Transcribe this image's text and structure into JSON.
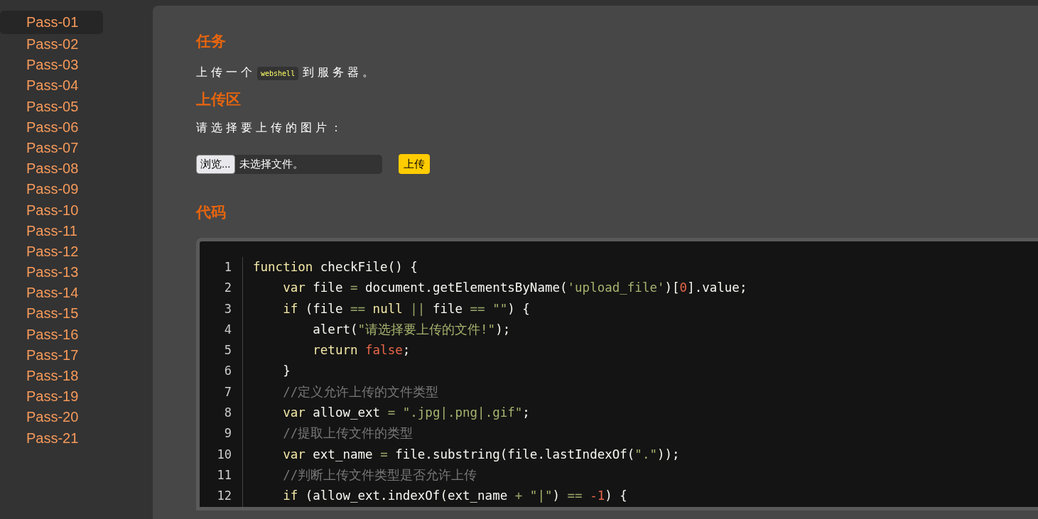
{
  "sidebar": {
    "items": [
      {
        "label": "Pass-01",
        "selected": true
      },
      {
        "label": "Pass-02",
        "selected": false
      },
      {
        "label": "Pass-03",
        "selected": false
      },
      {
        "label": "Pass-04",
        "selected": false
      },
      {
        "label": "Pass-05",
        "selected": false
      },
      {
        "label": "Pass-06",
        "selected": false
      },
      {
        "label": "Pass-07",
        "selected": false
      },
      {
        "label": "Pass-08",
        "selected": false
      },
      {
        "label": "Pass-09",
        "selected": false
      },
      {
        "label": "Pass-10",
        "selected": false
      },
      {
        "label": "Pass-11",
        "selected": false
      },
      {
        "label": "Pass-12",
        "selected": false
      },
      {
        "label": "Pass-13",
        "selected": false
      },
      {
        "label": "Pass-14",
        "selected": false
      },
      {
        "label": "Pass-15",
        "selected": false
      },
      {
        "label": "Pass-16",
        "selected": false
      },
      {
        "label": "Pass-17",
        "selected": false
      },
      {
        "label": "Pass-18",
        "selected": false
      },
      {
        "label": "Pass-19",
        "selected": false
      },
      {
        "label": "Pass-20",
        "selected": false
      },
      {
        "label": "Pass-21",
        "selected": false
      }
    ]
  },
  "task": {
    "heading": "任务",
    "text_before": "上传一个",
    "code": "webshell",
    "text_after": "到服务器。"
  },
  "upload": {
    "heading": "上传区",
    "prompt": "请选择要上传的图片：",
    "browse_button": "浏览...",
    "file_status": "未选择文件。",
    "submit_button": "上传"
  },
  "code": {
    "heading": "代码",
    "lines": [
      {
        "number": "1",
        "tokens": [
          {
            "kind": "keyword",
            "text": "function"
          },
          {
            "kind": "plain",
            "text": " checkFile() {"
          }
        ]
      },
      {
        "number": "2",
        "tokens": [
          {
            "kind": "keyword",
            "text": "    var"
          },
          {
            "kind": "plain",
            "text": " file "
          },
          {
            "kind": "operator",
            "text": "="
          },
          {
            "kind": "plain",
            "text": " document.getElementsByName("
          },
          {
            "kind": "string",
            "text": "'upload_file'"
          },
          {
            "kind": "plain",
            "text": ")["
          },
          {
            "kind": "number",
            "text": "0"
          },
          {
            "kind": "plain",
            "text": "].value;"
          }
        ]
      },
      {
        "number": "3",
        "tokens": [
          {
            "kind": "keyword",
            "text": "    if"
          },
          {
            "kind": "plain",
            "text": " (file "
          },
          {
            "kind": "operator",
            "text": "== "
          },
          {
            "kind": "keyword",
            "text": "null "
          },
          {
            "kind": "operator",
            "text": "||"
          },
          {
            "kind": "plain",
            "text": " file "
          },
          {
            "kind": "operator",
            "text": "== "
          },
          {
            "kind": "string",
            "text": "\"\""
          },
          {
            "kind": "plain",
            "text": ") {"
          }
        ]
      },
      {
        "number": "4",
        "tokens": [
          {
            "kind": "plain",
            "text": "        alert("
          },
          {
            "kind": "string",
            "text": "\"请选择要上传的文件!\""
          },
          {
            "kind": "plain",
            "text": ");"
          }
        ]
      },
      {
        "number": "5",
        "tokens": [
          {
            "kind": "keyword",
            "text": "        return "
          },
          {
            "kind": "number",
            "text": "false"
          },
          {
            "kind": "plain",
            "text": ";"
          }
        ]
      },
      {
        "number": "6",
        "tokens": [
          {
            "kind": "plain",
            "text": "    }"
          }
        ]
      },
      {
        "number": "7",
        "tokens": [
          {
            "kind": "comment",
            "text": "    //定义允许上传的文件类型"
          }
        ]
      },
      {
        "number": "8",
        "tokens": [
          {
            "kind": "keyword",
            "text": "    var"
          },
          {
            "kind": "plain",
            "text": " allow_ext "
          },
          {
            "kind": "operator",
            "text": "= "
          },
          {
            "kind": "string",
            "text": "\".jpg|.png|.gif\""
          },
          {
            "kind": "plain",
            "text": ";"
          }
        ]
      },
      {
        "number": "9",
        "tokens": [
          {
            "kind": "comment",
            "text": "    //提取上传文件的类型"
          }
        ]
      },
      {
        "number": "10",
        "tokens": [
          {
            "kind": "keyword",
            "text": "    var"
          },
          {
            "kind": "plain",
            "text": " ext_name "
          },
          {
            "kind": "operator",
            "text": "="
          },
          {
            "kind": "plain",
            "text": " file.substring(file.lastIndexOf("
          },
          {
            "kind": "string",
            "text": "\".\""
          },
          {
            "kind": "plain",
            "text": "));"
          }
        ]
      },
      {
        "number": "11",
        "tokens": [
          {
            "kind": "comment",
            "text": "    //判断上传文件类型是否允许上传"
          }
        ]
      },
      {
        "number": "12",
        "tokens": [
          {
            "kind": "keyword",
            "text": "    if"
          },
          {
            "kind": "plain",
            "text": " (allow_ext.indexOf(ext_name "
          },
          {
            "kind": "operator",
            "text": "+ "
          },
          {
            "kind": "string",
            "text": "\"|\""
          },
          {
            "kind": "plain",
            "text": ") "
          },
          {
            "kind": "operator",
            "text": "== "
          },
          {
            "kind": "number",
            "text": "-1"
          },
          {
            "kind": "plain",
            "text": ") {"
          }
        ]
      }
    ]
  }
}
